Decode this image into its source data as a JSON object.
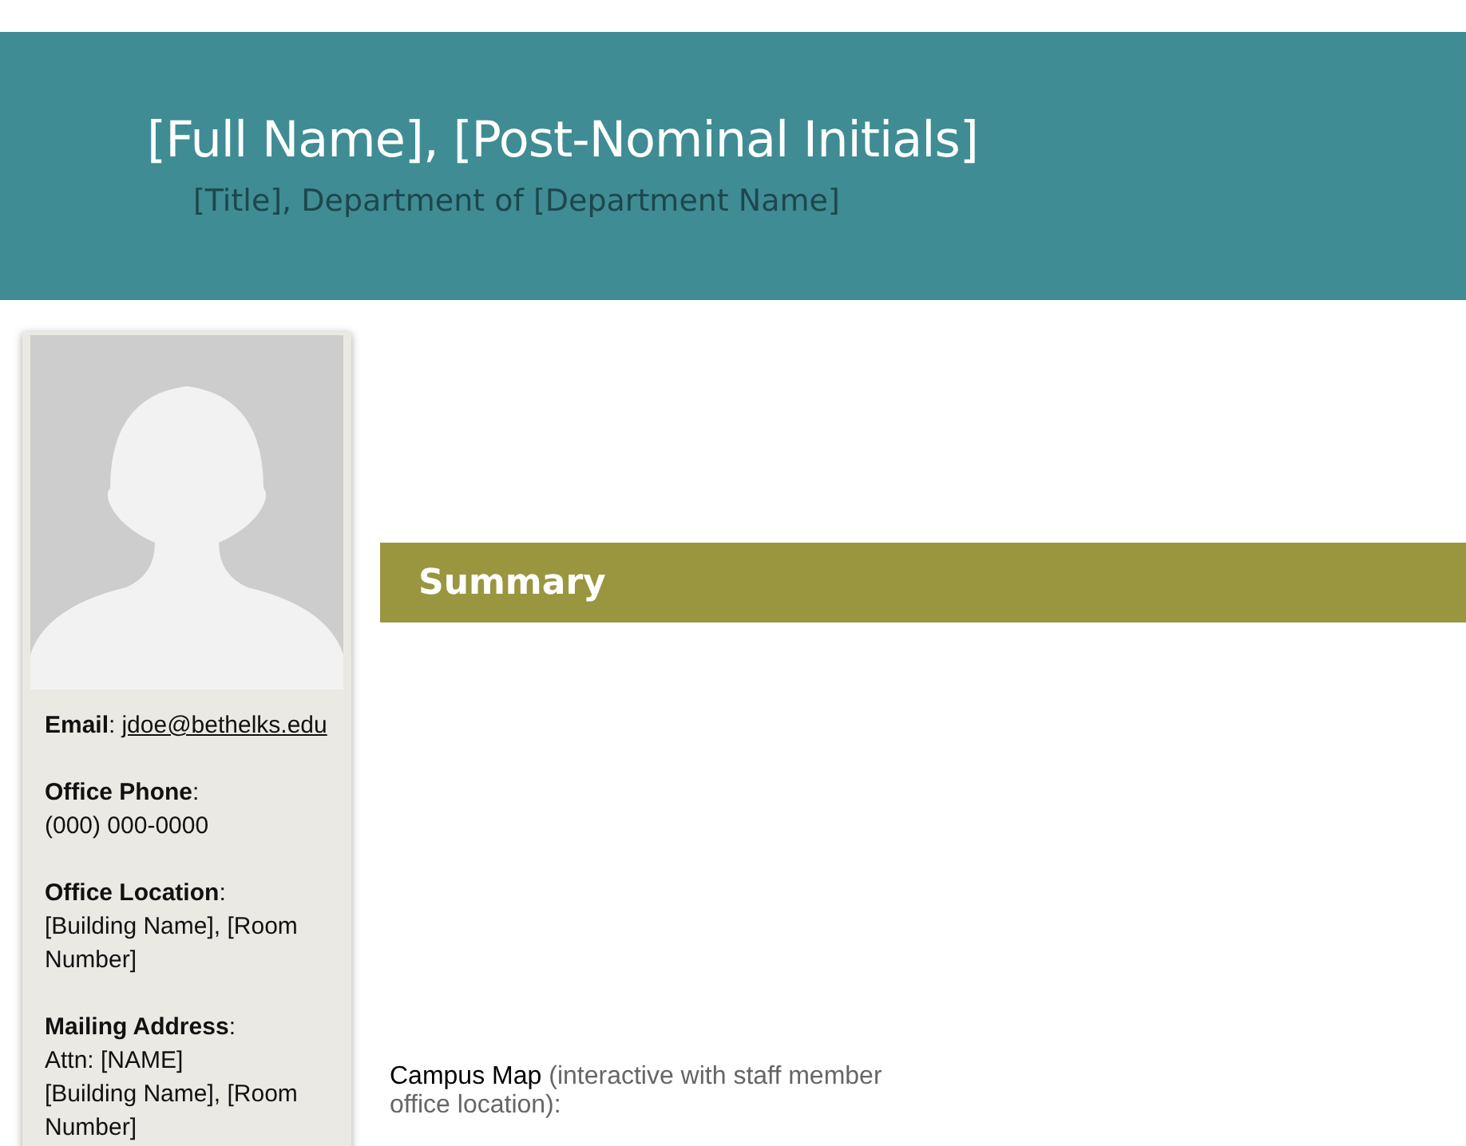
{
  "header": {
    "name": "[Full Name], [Post-Nominal Initials]",
    "title": "[Title], Department of [Department Name]"
  },
  "contact": [
    {
      "kind": "link",
      "label": "**Email**:",
      "value": "jdoe@bethelks.edu"
    },
    {
      "kind": "text",
      "label": "**Office Phone**:",
      "value": "(000) 000-0000"
    },
    {
      "kind": "text",
      "label": "**Office Location**:",
      "value": "[Building Name], [Room Number]"
    },
    {
      "kind": "text",
      "label": "**Mailing Address**:",
      "value": "Attn: [NAME]\n[Building Name], [Room Number]"
    }
  ],
  "summary": {
    "heading": "Summary"
  },
  "map": {
    "label": "Campus Map",
    "note": "(interactive with staff member office location):"
  }
}
